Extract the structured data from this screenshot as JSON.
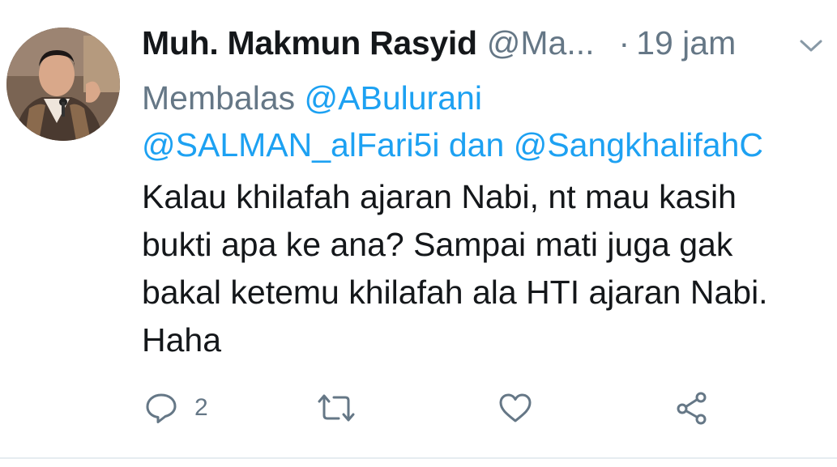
{
  "tweet": {
    "author_name": "Muh. Makmun Rasyid",
    "author_handle": "@Ma...",
    "separator": "·",
    "time": "19 jam",
    "reply_prefix": "Membalas",
    "reply_mention_1": "@ABulurani",
    "reply_mention_2": "@SALMAN_alFari5i",
    "reply_and": "dan",
    "reply_mention_3": "@SangkhalifahC",
    "text": "Kalau khilafah ajaran Nabi, nt mau kasih bukti apa ke ana? Sampai mati juga gak bakal ketemu khilafah ala HTI ajaran Nabi. Haha"
  },
  "actions": {
    "reply_count": "2",
    "retweet_count": "",
    "like_count": ""
  },
  "icons": {
    "reply": "reply-icon",
    "retweet": "retweet-icon",
    "like": "heart-icon",
    "share": "share-icon",
    "menu": "chevron-down-icon"
  },
  "colors": {
    "text": "#14171a",
    "secondary": "#657786",
    "link": "#1da1f2",
    "divider": "#e6ecf0"
  }
}
